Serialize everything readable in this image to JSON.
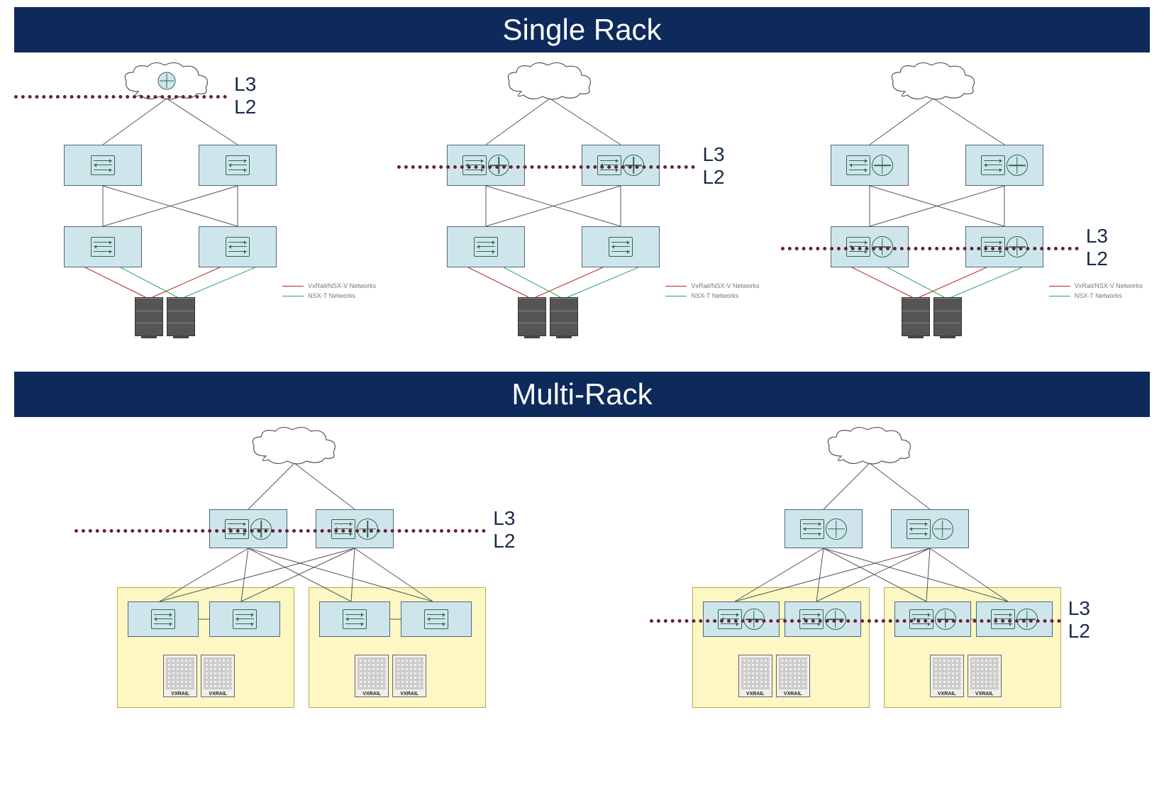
{
  "sections": {
    "single_rack": {
      "title": "Single Rack"
    },
    "multi_rack": {
      "title": "Multi-Rack"
    }
  },
  "labels": {
    "l3": "L3",
    "l2": "L2"
  },
  "legend": {
    "vxrail": "VxRail/NSX-V Networks",
    "nsx_t": "NSX-T Networks"
  },
  "node_label": "VXRAIL",
  "diagrams": {
    "single_rack": [
      {
        "id": "sr1",
        "cloud_has_router_icon": true,
        "boundary_at": "above-spine",
        "spine_has_router_icon": false,
        "leaf_has_router_icon": false
      },
      {
        "id": "sr2",
        "cloud_has_router_icon": false,
        "boundary_at": "through-spine",
        "spine_has_router_icon": true,
        "leaf_has_router_icon": false
      },
      {
        "id": "sr3",
        "cloud_has_router_icon": false,
        "boundary_at": "through-leaf",
        "spine_has_router_icon": true,
        "leaf_has_router_icon": true
      }
    ],
    "multi_rack": [
      {
        "id": "mr1",
        "boundary_at": "through-spine",
        "spine_has_router_icon": true,
        "rack_switch_has_router_icon": false
      },
      {
        "id": "mr2",
        "boundary_at": "through-rack",
        "spine_has_router_icon": true,
        "rack_switch_has_router_icon": true
      }
    ]
  }
}
